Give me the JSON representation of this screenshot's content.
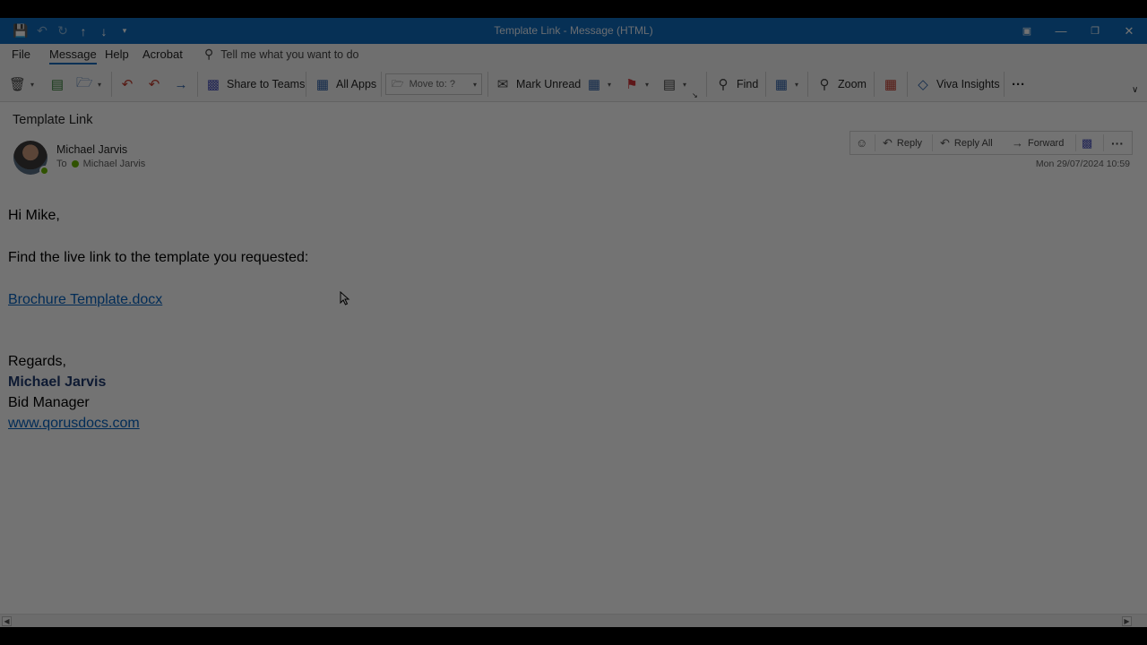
{
  "window": {
    "title": "Template Link  -  Message (HTML)",
    "quick_access": [
      "save-icon",
      "undo-icon",
      "redo-icon",
      "up-arrow-icon",
      "down-arrow-icon",
      "customize-icon"
    ],
    "controls": [
      "ribbon-display-icon",
      "minimize-icon",
      "restore-icon",
      "close-icon"
    ]
  },
  "menu": {
    "items": [
      "File",
      "Message",
      "Help",
      "Acrobat"
    ],
    "active": "Message",
    "tell_me": "Tell me what you want to do"
  },
  "ribbon": {
    "share_to_teams": "Share to Teams",
    "all_apps": "All Apps",
    "move_to": "Move to: ?",
    "mark_unread": "Mark Unread",
    "find": "Find",
    "zoom": "Zoom",
    "viva_insights": "Viva Insights",
    "more": "···"
  },
  "message": {
    "subject": "Template Link",
    "sender": "Michael Jarvis",
    "to_label": "To",
    "recipient": "Michael Jarvis",
    "date": "Mon 29/07/2024 10:59",
    "actions": {
      "reply": "Reply",
      "reply_all": "Reply All",
      "forward": "Forward",
      "more": "···"
    },
    "body": {
      "greeting": "Hi Mike,",
      "line1": "Find the live link to the template you requested:",
      "attachment_link": "Brochure Template.docx",
      "regards": "Regards,",
      "sig_name": "Michael Jarvis",
      "sig_title": "Bid Manager",
      "sig_website": "www.qorusdocs.com"
    }
  },
  "colors": {
    "accent": "#0f6cbd",
    "link": "#0563c1",
    "presence": "#6bb700",
    "signature_name": "#1f3b70"
  }
}
